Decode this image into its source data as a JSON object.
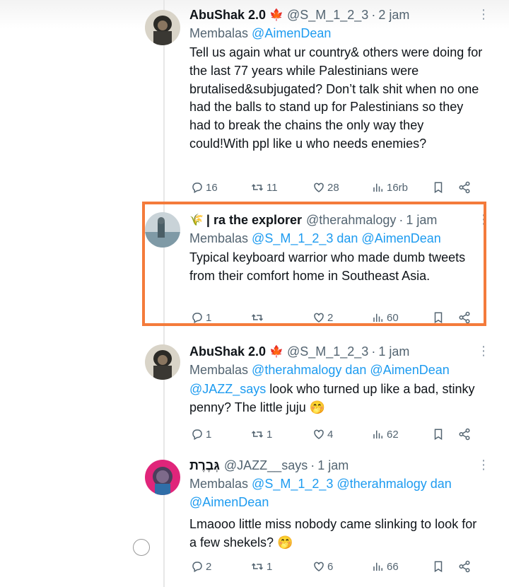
{
  "tweets": [
    {
      "display_name": "AbuShak 2.0",
      "flag": "🍁",
      "handle": "@S_M_1_2_3",
      "time": "2 jam",
      "reply_prefix": "Membalas",
      "reply_mentions": "@AimenDean",
      "reply_suffix": "",
      "body": "Tell us again what ur country& others were doing for the last 77 years while Palestinians were brutalised&subjugated? Don’t talk shit when no one had the balls to stand up for Palestinians so they had to break the chains the only way they could!With ppl like u who needs enemies?",
      "replies": "16",
      "retweets": "11",
      "likes": "28",
      "views": "16rb"
    },
    {
      "display_name": "| ra the explorer",
      "flag": "🌾",
      "handle": "@therahmalogy",
      "time": "1 jam",
      "reply_prefix": "Membalas",
      "reply_mentions": "@S_M_1_2_3 dan @AimenDean",
      "body": "Typical keyboard warrior who made dumb tweets from their comfort home in Southeast Asia.",
      "replies": "1",
      "retweets": "",
      "likes": "2",
      "views": "60"
    },
    {
      "display_name": "AbuShak 2.0",
      "flag": "🍁",
      "handle": "@S_M_1_2_3",
      "time": "1 jam",
      "reply_prefix": "Membalas",
      "reply_mentions": "@therahmalogy dan @AimenDean",
      "body_mention": "@JAZZ_says",
      "body": " look who turned up like a bad, stinky penny? The little juju 🤭",
      "replies": "1",
      "retweets": "1",
      "likes": "4",
      "views": "62"
    },
    {
      "display_name": "גְּבֶרֶת",
      "handle": "@JAZZ__says",
      "time": "1 jam",
      "reply_prefix": "Membalas",
      "reply_mentions": "@S_M_1_2_3 @therahmalogy dan @AimenDean",
      "body": "Lmaooo little miss nobody came slinking to look for a few shekels? 🤭",
      "replies": "2",
      "retweets": "1",
      "likes": "6",
      "views": "66"
    }
  ],
  "icons": {
    "reply": "reply-icon",
    "retweet": "retweet-icon",
    "like": "heart-icon",
    "views": "views-icon",
    "bookmark": "bookmark-icon",
    "share": "share-icon",
    "more": "more-icon"
  },
  "colors": {
    "accent": "#1d9bf0",
    "highlight": "#f47b3b",
    "muted": "#536471"
  }
}
